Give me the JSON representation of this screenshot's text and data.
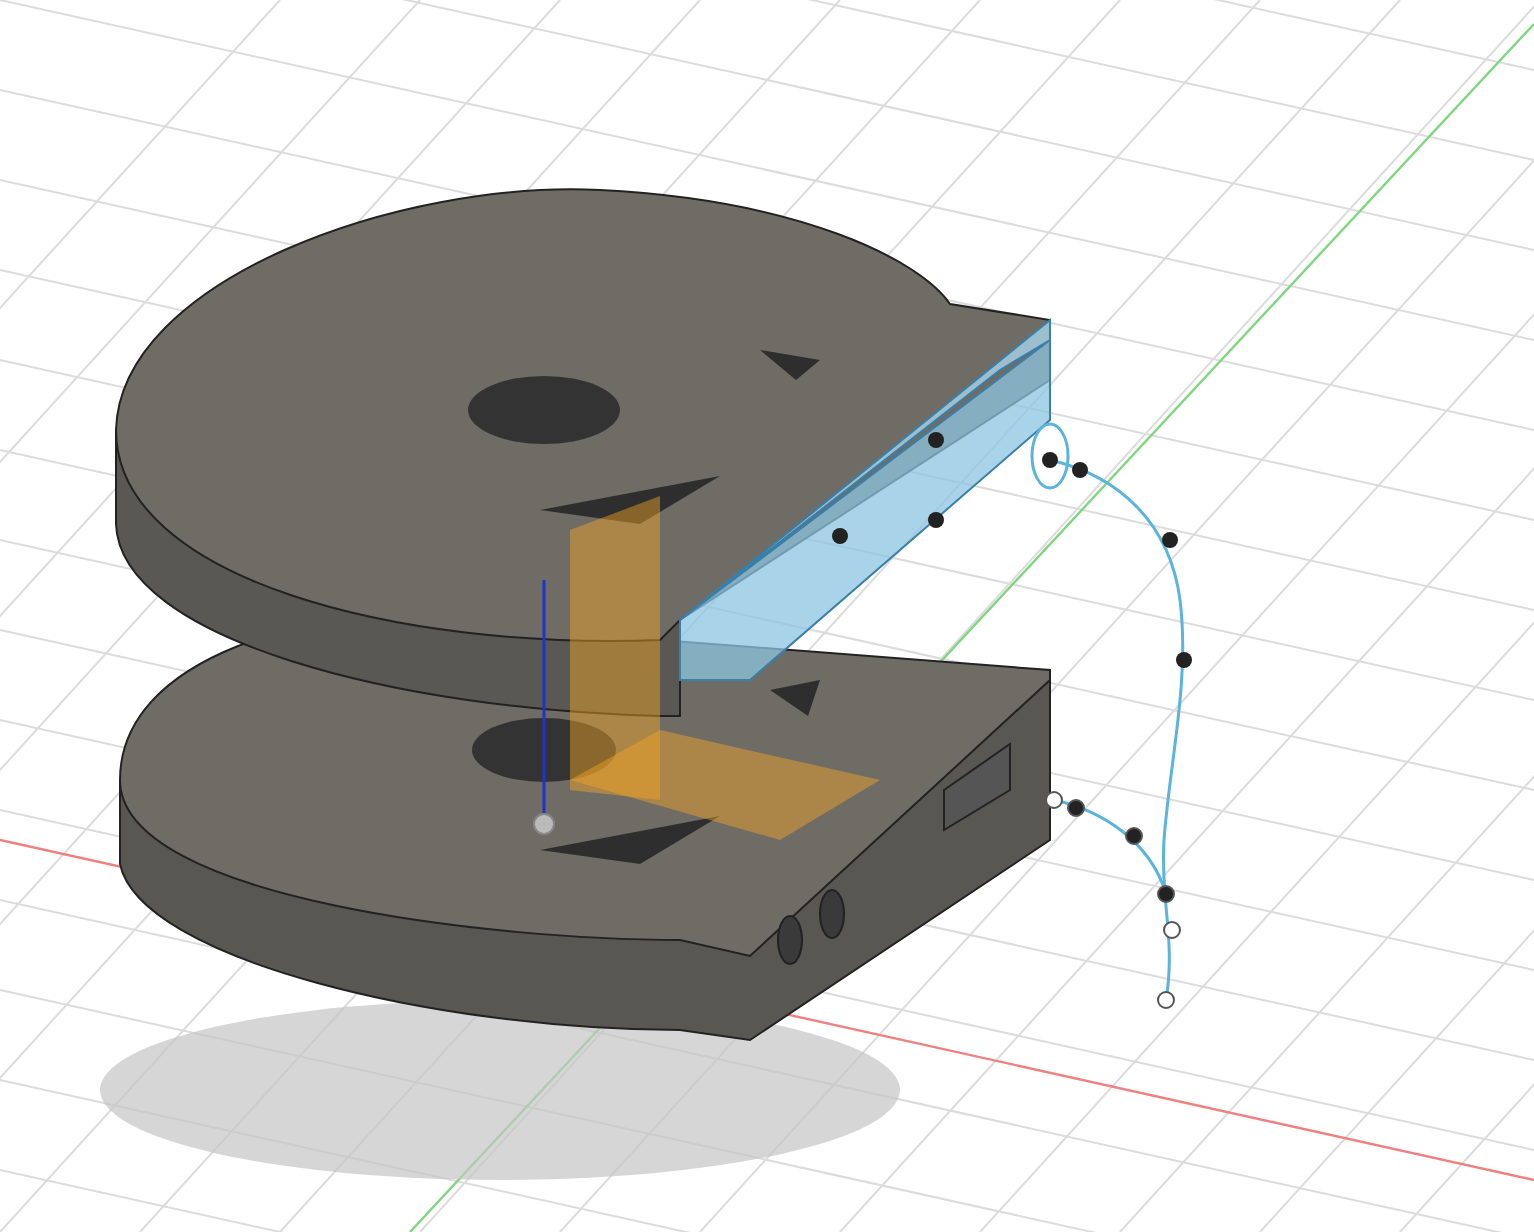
{
  "grid": {
    "visible": true
  },
  "sketch": {
    "visible": true
  },
  "selection": {
    "highlighted": true
  }
}
